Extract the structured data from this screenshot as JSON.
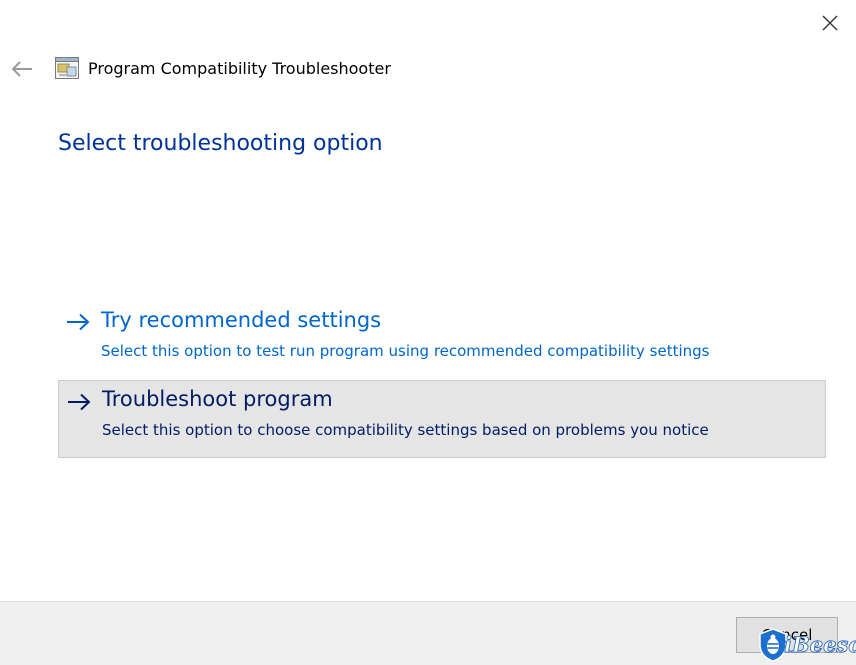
{
  "window": {
    "close_icon": "close-icon"
  },
  "header": {
    "back_icon": "back-arrow-icon",
    "app_icon": "program-compatibility-icon",
    "title": "Program Compatibility Troubleshooter"
  },
  "main": {
    "heading": "Select troubleshooting option",
    "options": [
      {
        "title": "Try recommended settings",
        "description": "Select this option to test run program using recommended compatibility settings",
        "icon": "arrow-right-icon",
        "highlighted": false
      },
      {
        "title": "Troubleshoot program",
        "description": "Select this option to choose compatibility settings based on problems you notice",
        "icon": "arrow-right-icon",
        "highlighted": true
      }
    ]
  },
  "footer": {
    "cancel_label": "Cancel"
  },
  "watermark": {
    "text": "iBeesoft"
  },
  "colors": {
    "heading": "#003399",
    "link": "#0066cc",
    "link_selected": "#001c66",
    "selected_bg": "#e5e5e5",
    "footer_bg": "#f0f0f0"
  }
}
